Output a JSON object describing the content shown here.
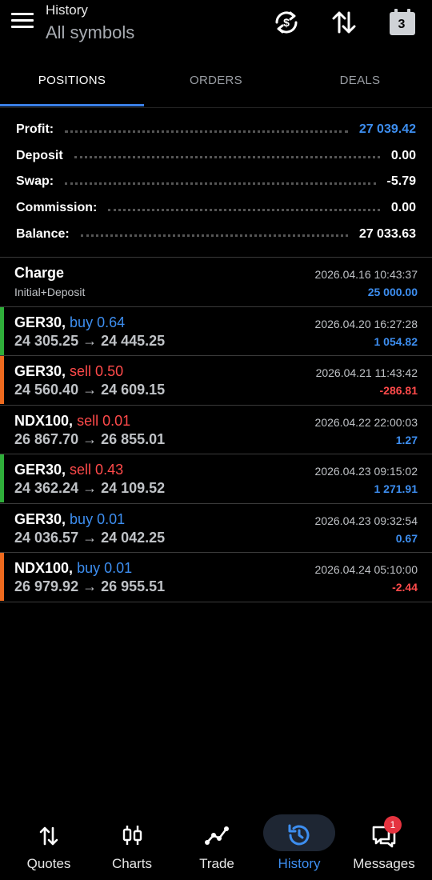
{
  "header": {
    "title_small": "History",
    "title_big": "All symbols",
    "calendar_day": "3",
    "icons": [
      "menu-icon",
      "currency-exchange-icon",
      "sort-icon",
      "calendar-icon"
    ]
  },
  "tabs": [
    {
      "label": "POSITIONS",
      "active": true
    },
    {
      "label": "ORDERS",
      "active": false
    },
    {
      "label": "DEALS",
      "active": false
    }
  ],
  "summary": [
    {
      "label": "Profit:",
      "value": "27 039.42"
    },
    {
      "label": "Deposit",
      "value": "0.00"
    },
    {
      "label": "Swap:",
      "value": "-5.79"
    },
    {
      "label": "Commission:",
      "value": "0.00"
    },
    {
      "label": "Balance:",
      "value": "27 033.63"
    }
  ],
  "charge": {
    "title": "Charge",
    "subtitle": "Initial+Deposit",
    "date": "2026.04.16 10:43:37",
    "amount": "25 000.00"
  },
  "deals": [
    {
      "symbol": "GER30,",
      "side": "buy 0.64",
      "prices": "24 305.25 → 24 445.25",
      "date": "2026.04.20 16:27:28",
      "amount": "1 054.82"
    },
    {
      "symbol": "GER30,",
      "side": "sell 0.50",
      "prices": "24 560.40 → 24 609.15",
      "date": "2026.04.21 11:43:42",
      "amount": "-286.81"
    },
    {
      "symbol": "NDX100,",
      "side": "sell 0.01",
      "prices": "26 867.70 → 26 855.01",
      "date": "2026.04.22 22:00:03",
      "amount": "1.27"
    },
    {
      "symbol": "GER30,",
      "side": "sell 0.43",
      "prices": "24 362.24 → 24 109.52",
      "date": "2026.04.23 09:15:02",
      "amount": "1 271.91"
    },
    {
      "symbol": "GER30,",
      "side": "buy 0.01",
      "prices": "24 036.57 → 24 042.25",
      "date": "2026.04.23 09:32:54",
      "amount": "0.67"
    },
    {
      "symbol": "NDX100,",
      "side": "buy 0.01",
      "prices": "26 979.92 → 26 955.51",
      "date": "2026.04.24 05:10:00",
      "amount": "-2.44"
    }
  ],
  "nav": [
    {
      "label": "Quotes",
      "icon": "quotes-icon"
    },
    {
      "label": "Charts",
      "icon": "candles-icon"
    },
    {
      "label": "Trade",
      "icon": "trade-icon"
    },
    {
      "label": "History",
      "icon": "history-icon",
      "active": true
    },
    {
      "label": "Messages",
      "icon": "messages-icon"
    }
  ],
  "messages_badge": "1",
  "colors": {
    "accent": "#3d8ef0",
    "sell": "#ff4a4a",
    "profit_bar": "#2fae3a",
    "loss_bar": "#ee6a1e",
    "background": "#000000"
  }
}
